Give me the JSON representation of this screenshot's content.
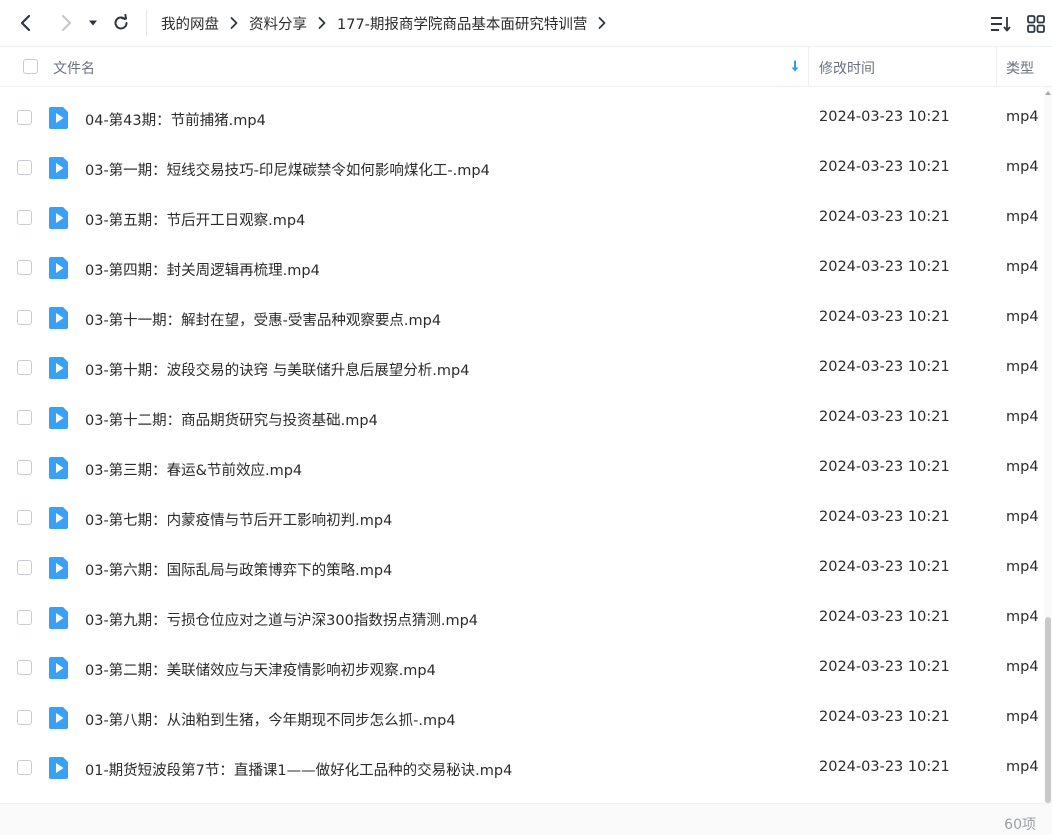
{
  "breadcrumb": [
    {
      "label": "我的网盘"
    },
    {
      "label": "资料分享"
    },
    {
      "label": "177-期报商学院商品基本面研究特训营"
    }
  ],
  "header": {
    "name": "文件名",
    "time": "修改时间",
    "type": "类型"
  },
  "files": [
    {
      "name": "04-第43期：节前捕猪.mp4",
      "time": "2024-03-23 10:21",
      "type": "mp4"
    },
    {
      "name": "03-第一期：短线交易技巧-印尼煤碳禁令如何影响煤化工-.mp4",
      "time": "2024-03-23 10:21",
      "type": "mp4"
    },
    {
      "name": "03-第五期：节后开工日观察.mp4",
      "time": "2024-03-23 10:21",
      "type": "mp4"
    },
    {
      "name": "03-第四期：封关周逻辑再梳理.mp4",
      "time": "2024-03-23 10:21",
      "type": "mp4"
    },
    {
      "name": "03-第十一期：解封在望，受惠-受害品种观察要点.mp4",
      "time": "2024-03-23 10:21",
      "type": "mp4"
    },
    {
      "name": "03-第十期：波段交易的诀窍 与美联储升息后展望分析.mp4",
      "time": "2024-03-23 10:21",
      "type": "mp4"
    },
    {
      "name": "03-第十二期：商品期货研究与投资基础.mp4",
      "time": "2024-03-23 10:21",
      "type": "mp4"
    },
    {
      "name": "03-第三期：春运&节前效应.mp4",
      "time": "2024-03-23 10:21",
      "type": "mp4"
    },
    {
      "name": "03-第七期：内蒙疫情与节后开工影响初判.mp4",
      "time": "2024-03-23 10:21",
      "type": "mp4"
    },
    {
      "name": "03-第六期：国际乱局与政策博弈下的策略.mp4",
      "time": "2024-03-23 10:21",
      "type": "mp4"
    },
    {
      "name": "03-第九期：亏损仓位应对之道与沪深300指数拐点猜测.mp4",
      "time": "2024-03-23 10:21",
      "type": "mp4"
    },
    {
      "name": "03-第二期：美联储效应与天津疫情影响初步观察.mp4",
      "time": "2024-03-23 10:21",
      "type": "mp4"
    },
    {
      "name": "03-第八期：从油粕到生猪，今年期现不同步怎么抓-.mp4",
      "time": "2024-03-23 10:21",
      "type": "mp4"
    },
    {
      "name": "01-期货短波段第7节：直播课1——做好化工品种的交易秘诀.mp4",
      "time": "2024-03-23 10:21",
      "type": "mp4"
    }
  ],
  "footer": {
    "count": "60项"
  },
  "icons": {
    "back": "chevron-left-icon",
    "forward": "chevron-right-icon",
    "history": "caret-down-icon",
    "refresh": "refresh-icon",
    "sort": "sort-list-icon",
    "grid": "grid-view-icon",
    "file": "video-file-icon"
  },
  "colors": {
    "accent": "#2f9bf0",
    "file_icon": "#3aa0f5"
  }
}
